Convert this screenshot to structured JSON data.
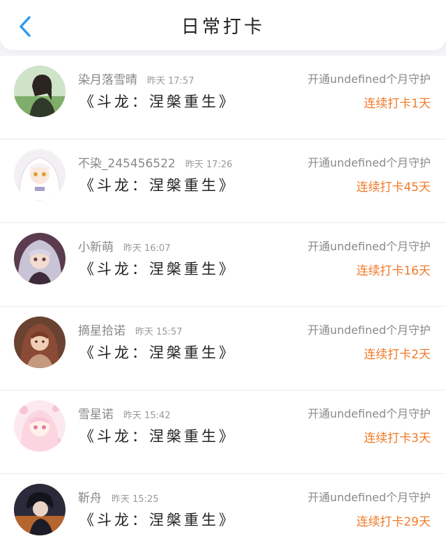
{
  "header": {
    "title": "日常打卡"
  },
  "colors": {
    "accent": "#f07a2a",
    "back": "#2f9bf0"
  },
  "items": [
    {
      "name": "染月落雪晴",
      "time": "昨天 17:57",
      "book": "《斗龙：涅槃重生》",
      "guard": "开通undefined个月守护",
      "streak": "连续打卡1天",
      "avatar_icon": "girl-photo-avatar"
    },
    {
      "name": "不染_245456522",
      "time": "昨天 17:26",
      "book": "《斗龙：涅槃重生》",
      "guard": "开通undefined个月守护",
      "streak": "连续打卡45天",
      "avatar_icon": "white-hair-anime-avatar"
    },
    {
      "name": "小新萌",
      "time": "昨天 16:07",
      "book": "《斗龙：涅槃重生》",
      "guard": "开通undefined个月守护",
      "streak": "连续打卡16天",
      "avatar_icon": "silver-hair-anime-avatar"
    },
    {
      "name": "摘星拾诺",
      "time": "昨天 15:57",
      "book": "《斗龙：涅槃重生》",
      "guard": "开通undefined个月守护",
      "streak": "连续打卡2天",
      "avatar_icon": "painted-girl-avatar"
    },
    {
      "name": "雪星诺",
      "time": "昨天 15:42",
      "book": "《斗龙：涅槃重生》",
      "guard": "开通undefined个月守护",
      "streak": "连续打卡3天",
      "avatar_icon": "pink-anime-avatar"
    },
    {
      "name": "靳舟",
      "time": "昨天 15:25",
      "book": "《斗龙：涅槃重生》",
      "guard": "开通undefined个月守护",
      "streak": "连续打卡29天",
      "avatar_icon": "dark-anime-boy-avatar"
    }
  ]
}
